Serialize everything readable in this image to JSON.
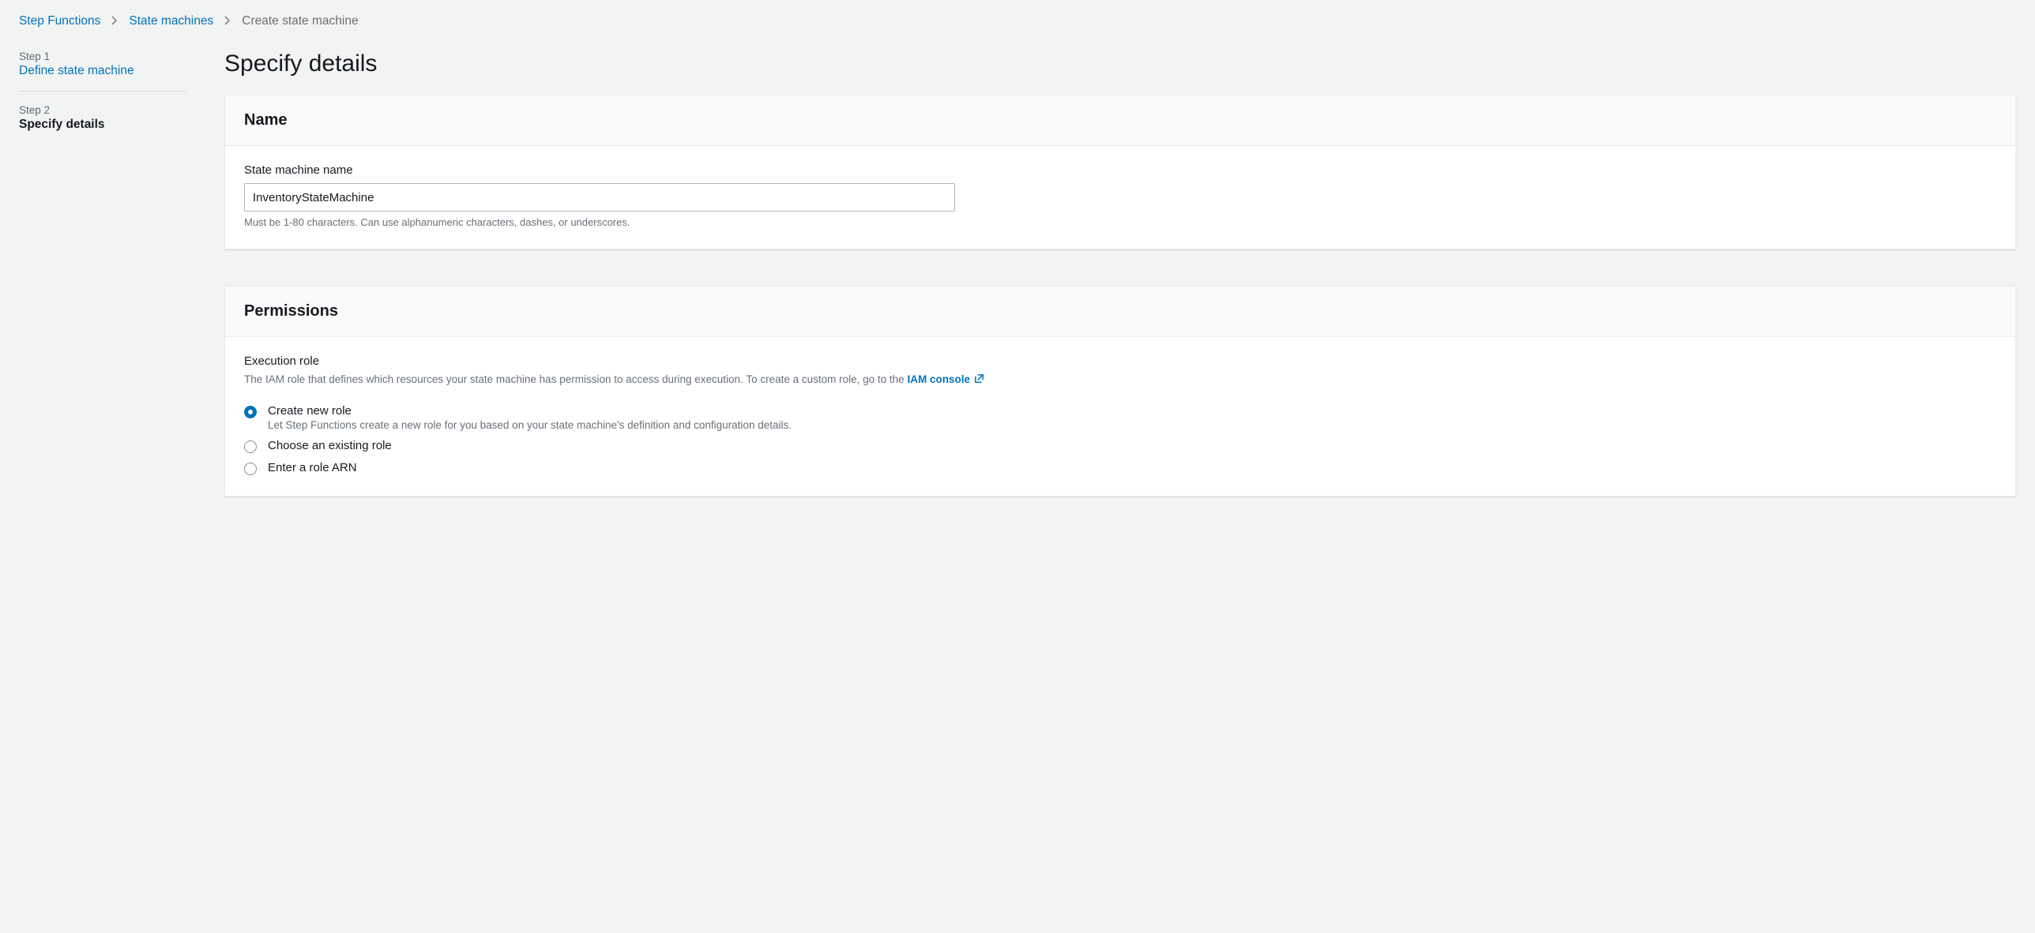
{
  "breadcrumb": {
    "items": [
      {
        "label": "Step Functions"
      },
      {
        "label": "State machines"
      },
      {
        "label": "Create state machine"
      }
    ]
  },
  "wizard": {
    "step1": {
      "num": "Step 1",
      "title": "Define state machine"
    },
    "step2": {
      "num": "Step 2",
      "title": "Specify details"
    }
  },
  "page_title": "Specify details",
  "name_panel": {
    "heading": "Name",
    "field_label": "State machine name",
    "value": "InventoryStateMachine",
    "hint": "Must be 1-80 characters. Can use alphanumeric characters, dashes, or underscores."
  },
  "permissions_panel": {
    "heading": "Permissions",
    "role_label": "Execution role",
    "role_desc_prefix": "The IAM role that defines which resources your state machine has permission to access during execution. To create a custom role, go to the ",
    "role_link": "IAM console",
    "options": [
      {
        "label": "Create new role",
        "desc": "Let Step Functions create a new role for you based on your state machine's definition and configuration details.",
        "checked": true
      },
      {
        "label": "Choose an existing role",
        "desc": "",
        "checked": false
      },
      {
        "label": "Enter a role ARN",
        "desc": "",
        "checked": false
      }
    ]
  }
}
